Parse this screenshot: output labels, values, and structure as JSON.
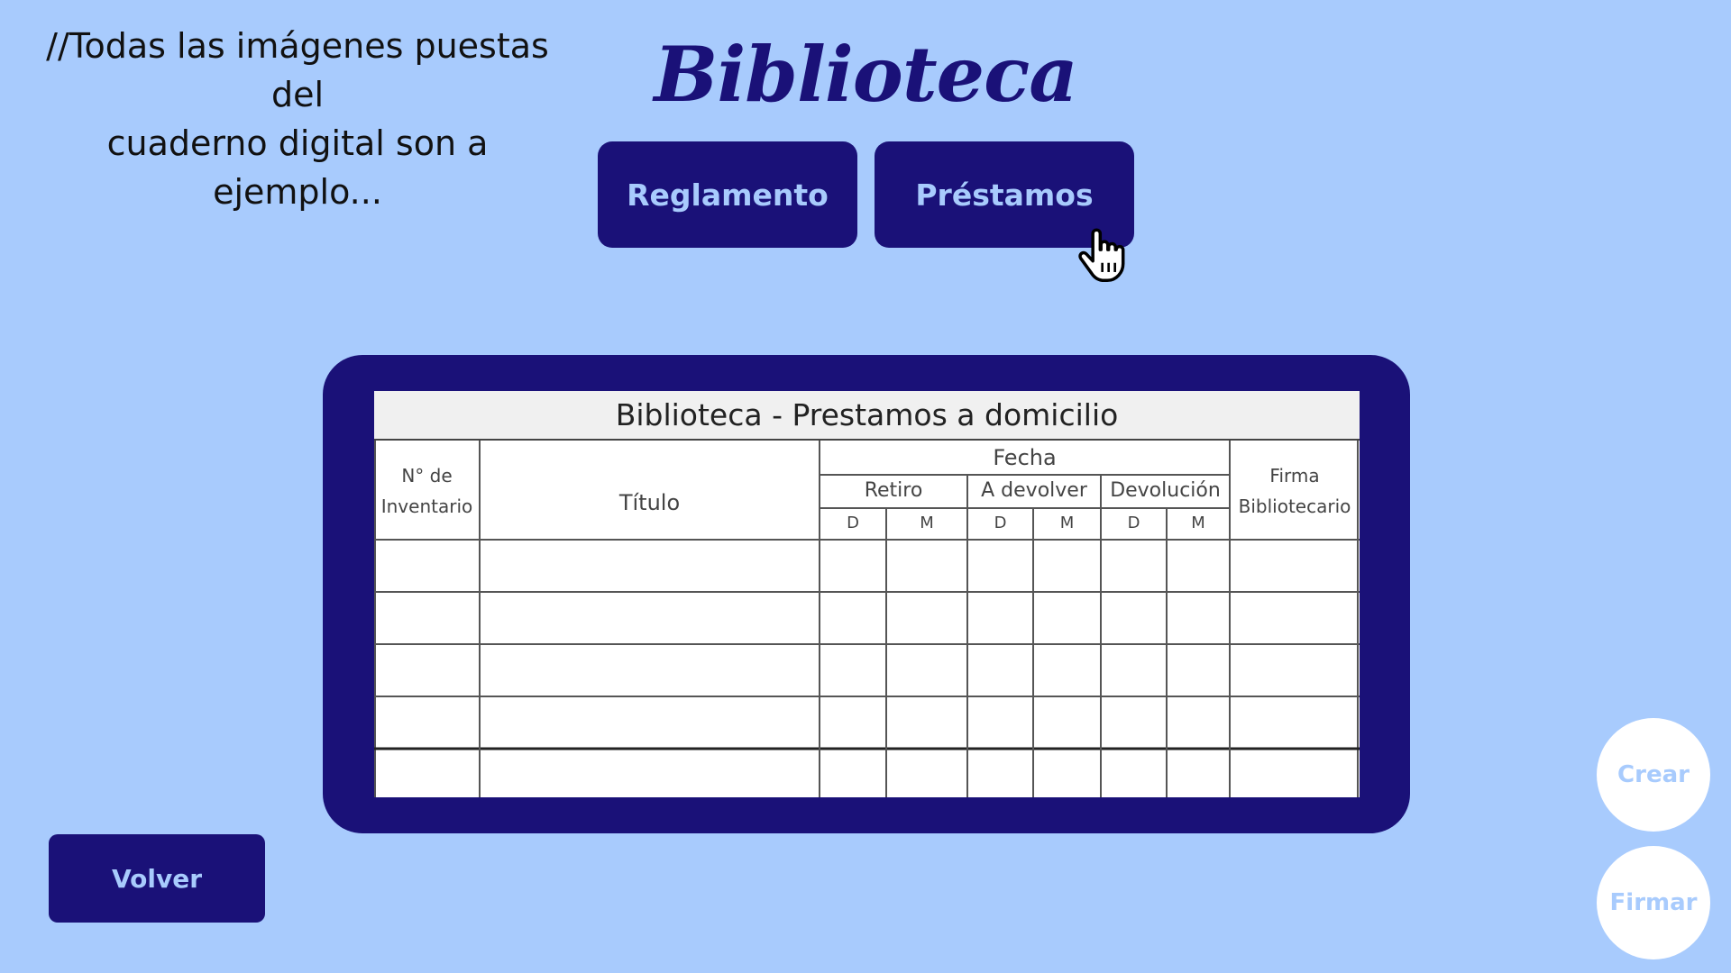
{
  "note": {
    "line1": "//Todas las imágenes puestas del",
    "line2": "cuaderno digital son a ejemplo..."
  },
  "header": {
    "title": "Biblioteca"
  },
  "nav": {
    "reglamento_label": "Reglamento",
    "prestamos_label": "Préstamos"
  },
  "form": {
    "title": "Biblioteca - Prestamos a domicilio",
    "col_inventario_1": "N° de",
    "col_inventario_2": "Inventario",
    "col_titulo": "Título",
    "col_fecha": "Fecha",
    "col_retiro": "Retiro",
    "col_a_devolver": "A devolver",
    "col_devolucion": "Devolución",
    "col_firma_1": "Firma",
    "col_firma_2": "Bibliotecario",
    "day_label": "D",
    "month_label": "M",
    "empty_rows": 5
  },
  "footer": {
    "volver_label": "Volver"
  },
  "actions": {
    "crear_label": "Crear",
    "firmar_label": "Firmar"
  },
  "colors": {
    "background": "#a8cbfd",
    "primary": "#1a1178",
    "button_text": "#a8cbfd"
  }
}
